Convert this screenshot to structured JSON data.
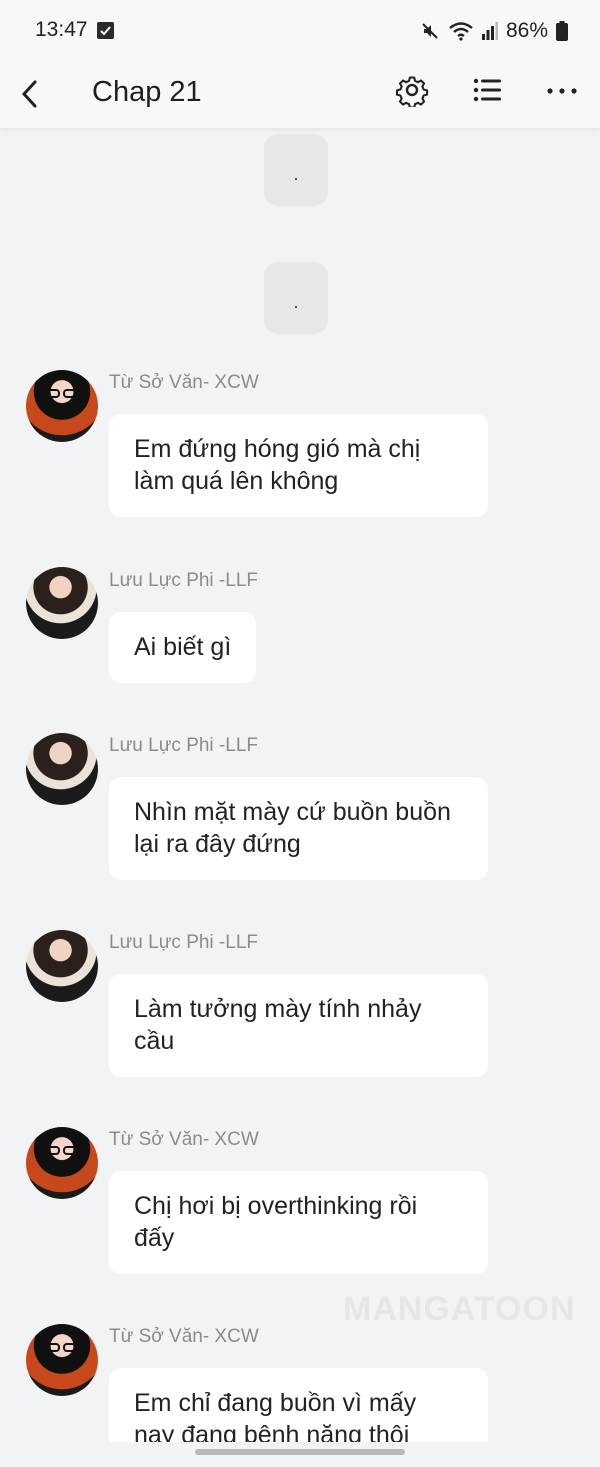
{
  "status_bar": {
    "time": "13:47",
    "battery": "86%"
  },
  "app_bar": {
    "title": "Chap 21"
  },
  "dot_bubbles": [
    ".",
    "."
  ],
  "messages": [
    {
      "sender": "Từ Sở Văn- XCW",
      "text": "Em đứng hóng gió mà chị làm quá lên không"
    },
    {
      "sender": "Lưu Lực Phi -LLF",
      "text": "Ai biết gì"
    },
    {
      "sender": "Lưu Lực Phi -LLF",
      "text": "Nhìn mặt mày cứ buồn buồn lại ra đây đứng"
    },
    {
      "sender": "Lưu Lực Phi -LLF",
      "text": "Làm tưởng mày tính nhảy cầu"
    },
    {
      "sender": "Từ Sở Văn- XCW",
      "text": "Chị hơi bị overthinking rồi đấy"
    },
    {
      "sender": "Từ Sở Văn- XCW",
      "text": "Em chỉ đang buồn vì mấy nay đang bệnh năng thôi"
    }
  ],
  "watermark": "MANGATOON",
  "icons": {
    "back": "chevron-left-icon",
    "settings": "gear-icon",
    "list": "list-icon",
    "more": "more-horizontal-icon"
  },
  "colors": {
    "background": "#f2f3f5",
    "bubble": "#ffffff",
    "sender": "#8b8b8b"
  }
}
